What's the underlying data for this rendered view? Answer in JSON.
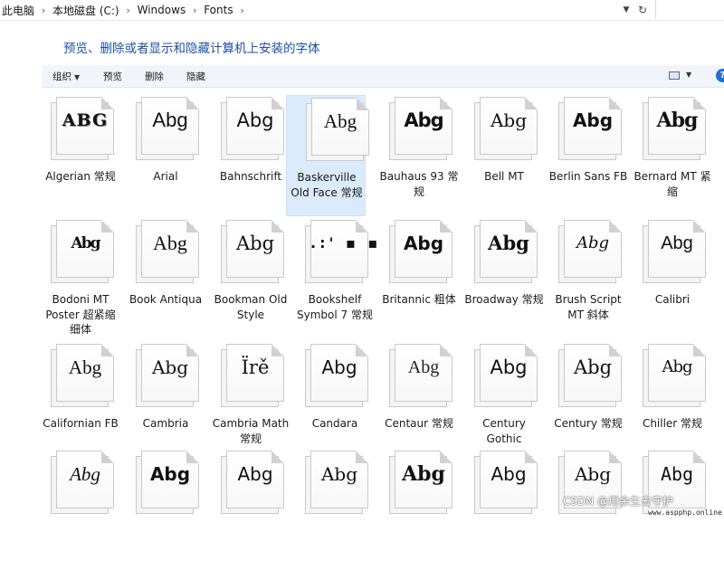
{
  "address": {
    "crumbs": [
      "此电脑",
      "本地磁盘 (C:)",
      "Windows",
      "Fonts"
    ],
    "separator": "›",
    "dropdown_icon": "chevron-down-icon",
    "refresh_icon": "refresh-icon"
  },
  "heading": "预览、删除或者显示和隐藏计算机上安装的字体",
  "commands": {
    "organize": "组织",
    "preview": "预览",
    "delete": "删除",
    "hide": "隐藏",
    "help": "?"
  },
  "fonts": [
    {
      "sample": "ABG",
      "label": "Algerian 常规",
      "style": "s-algerian"
    },
    {
      "sample": "Abg",
      "label": "Arial",
      "style": "s-arial"
    },
    {
      "sample": "Abg",
      "label": "Bahnschrift",
      "style": "s-bahn"
    },
    {
      "sample": "Abg",
      "label": "Baskerville Old Face 常规",
      "style": "s-basker",
      "selected": true
    },
    {
      "sample": "Abg",
      "label": "Bauhaus 93 常规",
      "style": "s-bauhaus"
    },
    {
      "sample": "Abg",
      "label": "Bell MT",
      "style": "s-bell"
    },
    {
      "sample": "Abg",
      "label": "Berlin Sans FB",
      "style": "s-berlin"
    },
    {
      "sample": "Abg",
      "label": "Bernard MT 紧缩",
      "style": "s-bernard"
    },
    {
      "sample": "Abg",
      "label": "Bodoni MT Poster 超紧缩 细体",
      "style": "s-bodoni"
    },
    {
      "sample": "Abg",
      "label": "Book Antiqua",
      "style": "s-book"
    },
    {
      "sample": "Abg",
      "label": "Bookman Old Style",
      "style": "s-bookman"
    },
    {
      "sample": ".:' ▪ ▪",
      "label": "Bookshelf Symbol 7 常规",
      "style": "s-bookshelf"
    },
    {
      "sample": "Abg",
      "label": "Britannic 粗体",
      "style": "s-britannic"
    },
    {
      "sample": "Abg",
      "label": "Broadway 常规",
      "style": "s-broadway"
    },
    {
      "sample": "Abg",
      "label": "Brush Script MT 斜体",
      "style": "s-brush"
    },
    {
      "sample": "Abg",
      "label": "Calibri",
      "style": "s-calibri"
    },
    {
      "sample": "Abg",
      "label": "Californian FB",
      "style": "s-californian"
    },
    {
      "sample": "Abg",
      "label": "Cambria",
      "style": "s-cambria"
    },
    {
      "sample": "Ïrě",
      "label": "Cambria Math 常规",
      "style": "s-cambriamath"
    },
    {
      "sample": "Abg",
      "label": "Candara",
      "style": "s-candara"
    },
    {
      "sample": "Abg",
      "label": "Centaur 常规",
      "style": "s-centaur"
    },
    {
      "sample": "Abg",
      "label": "Century Gothic",
      "style": "s-century"
    },
    {
      "sample": "Abg",
      "label": "Century 常规",
      "style": "s-centuryr"
    },
    {
      "sample": "Abg",
      "label": "Chiller 常规",
      "style": "s-chiller"
    },
    {
      "sample": "Abg",
      "label": "",
      "style": "s-r4a"
    },
    {
      "sample": "Abg",
      "label": "",
      "style": "s-r4b"
    },
    {
      "sample": "Abg",
      "label": "",
      "style": "s-r4c"
    },
    {
      "sample": "Abg",
      "label": "",
      "style": "s-r4d"
    },
    {
      "sample": "Abg",
      "label": "",
      "style": "s-r4e"
    },
    {
      "sample": "Abg",
      "label": "",
      "style": "s-r4f"
    },
    {
      "sample": "Abg",
      "label": "",
      "style": "s-r4g"
    },
    {
      "sample": "Abg",
      "label": "",
      "style": "s-r4h"
    }
  ],
  "watermark": {
    "text": "CSDN @用余生去守护",
    "site": "www.aspphp.online"
  }
}
